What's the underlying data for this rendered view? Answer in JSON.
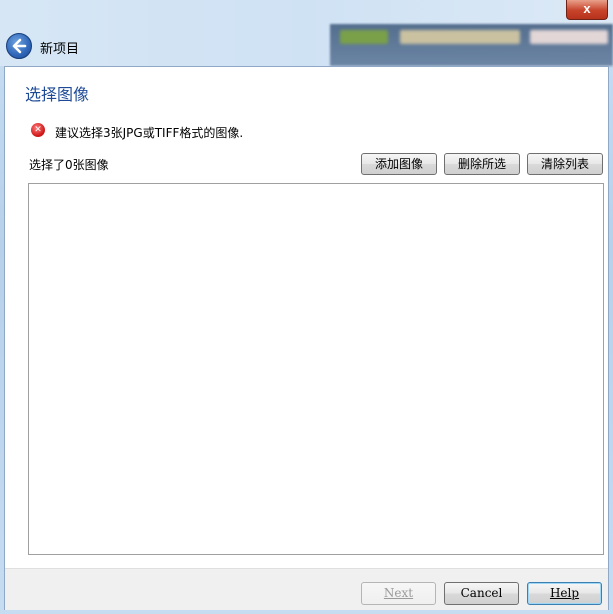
{
  "window": {
    "title": "新项目",
    "close_label": "x"
  },
  "page": {
    "title": "选择图像"
  },
  "warning": {
    "icon": "error-circle-icon",
    "icon_glyph": "✕",
    "message": "建议选择3张JPG或TIFF格式的图像."
  },
  "selection": {
    "count_label": "选择了0张图像"
  },
  "toolbar": {
    "add_label": "添加图像",
    "delete_label": "删除所选",
    "clear_label": "清除列表"
  },
  "image_list": {
    "items": []
  },
  "footer": {
    "next_label": "Next",
    "cancel_label": "Cancel",
    "help_label": "Help"
  },
  "colors": {
    "title_accent": "#1e4a96",
    "error": "#d01919"
  }
}
